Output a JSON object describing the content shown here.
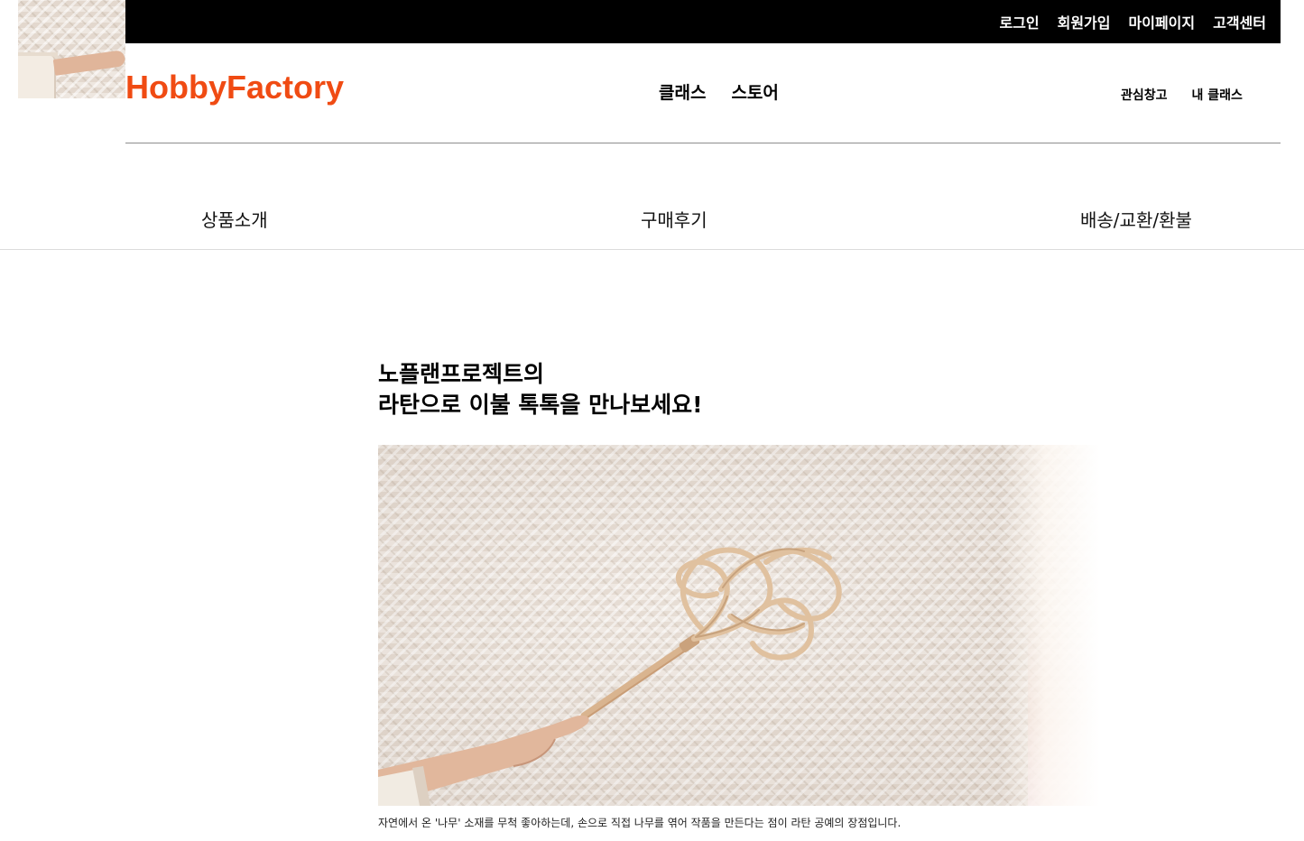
{
  "top_bar": {
    "links": [
      "로그인",
      "회원가입",
      "마이페이지",
      "고객센터"
    ]
  },
  "header": {
    "logo": "HobbyFactory",
    "main_nav": [
      "클래스",
      "스토어"
    ],
    "user_nav": [
      "관심창고",
      "내 클래스"
    ]
  },
  "tabs": [
    "상품소개",
    "구매후기",
    "배송/교환/환불"
  ],
  "content": {
    "headline_line1": "노플랜프로젝트의",
    "headline_line2": "라탄으로 이불 톡톡을 만나보세요!",
    "caption": "자연에서 온 '나무' 소재를 무척 좋아하는데, 손으로 직접 나무를 엮어 작품을 만든다는 점이 라탄 공예의 장점입니다."
  },
  "colors": {
    "brand": "#f04b13",
    "top_bar_bg": "#000000",
    "top_bar_text": "#ffffff"
  }
}
